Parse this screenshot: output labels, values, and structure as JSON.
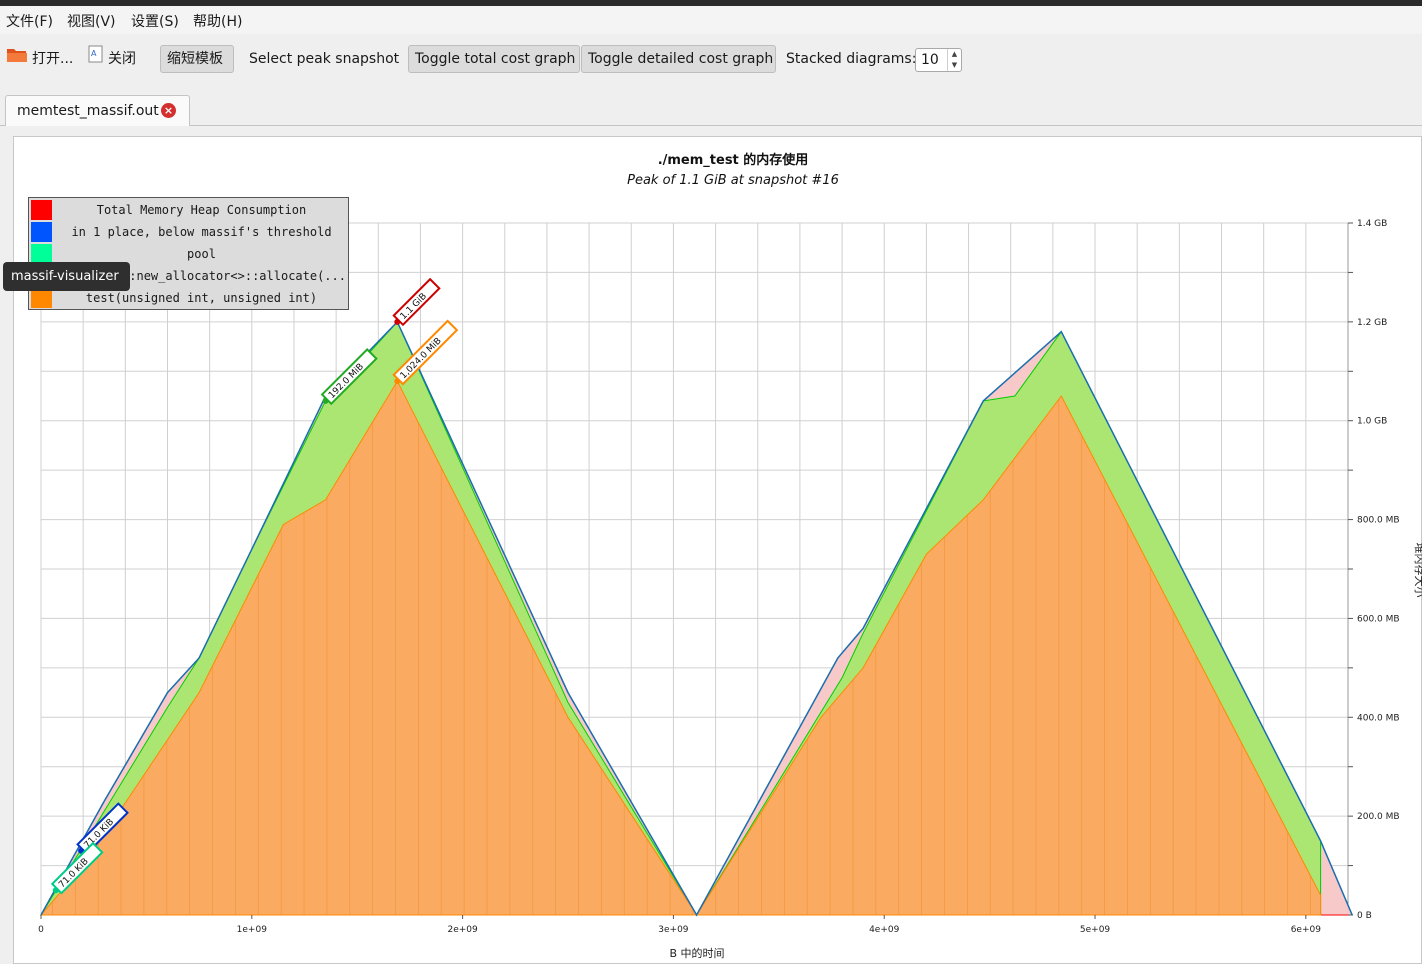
{
  "menubar": {
    "items": [
      "文件(F)",
      "视图(V)",
      "设置(S)",
      "帮助(H)"
    ]
  },
  "toolbar": {
    "open_label": "打开...",
    "close_label": "关闭",
    "shorten_templates_label": "缩短模板",
    "select_peak_label": "Select peak snapshot",
    "toggle_total_label": "Toggle total cost graph",
    "toggle_detailed_label": "Toggle detailed cost graph",
    "stacked_label": "Stacked diagrams:",
    "stacked_value": "10"
  },
  "tab": {
    "label": "memtest_massif.out"
  },
  "tooltip": {
    "text": "massif-visualizer"
  },
  "legend": [
    {
      "label": "Total Memory Heap Consumption",
      "color": "#ff0000"
    },
    {
      "label": "in 1 place, below massif's threshold",
      "color": "#0055ff"
    },
    {
      "label": "pool",
      "color": "#00ff99"
    },
    {
      "label": "__gnu_cxx::new_allocator<>::allocate(...",
      "color": "#00dd00"
    },
    {
      "label": "test(unsigned int, unsigned int)",
      "color": "#ff8800"
    }
  ],
  "chart_data": {
    "type": "area",
    "title": "./mem_test 的内存使用",
    "subtitle": "Peak of 1.1 GiB at snapshot #16",
    "xlabel": "B 中的时间",
    "ylabel": "堆内存大小",
    "xlim": [
      0,
      6200000000
    ],
    "ylim": [
      0,
      1.4
    ],
    "x_ticks": [
      {
        "value": 0,
        "label": "0"
      },
      {
        "value": 1000000000,
        "label": "1e+09"
      },
      {
        "value": 2000000000,
        "label": "2e+09"
      },
      {
        "value": 3000000000,
        "label": "3e+09"
      },
      {
        "value": 4000000000,
        "label": "4e+09"
      },
      {
        "value": 5000000000,
        "label": "5e+09"
      },
      {
        "value": 6000000000,
        "label": "6e+09"
      }
    ],
    "y_ticks": [
      {
        "value": 0,
        "label": "0 B"
      },
      {
        "value": 0.2,
        "label": "200.0 MB"
      },
      {
        "value": 0.4,
        "label": "400.0 MB"
      },
      {
        "value": 0.6,
        "label": "600.0 MB"
      },
      {
        "value": 0.8,
        "label": "800.0 MB"
      },
      {
        "value": 1.0,
        "label": "1.0 GB"
      },
      {
        "value": 1.2,
        "label": "1.2 GB"
      },
      {
        "value": 1.4,
        "label": "1.4 GB"
      }
    ],
    "series": [
      {
        "name": "Total Memory Heap Consumption",
        "color": "#ff0000",
        "fill": "#f7c6c6",
        "points": [
          [
            0,
            0
          ],
          [
            300000000,
            0.23
          ],
          [
            600000000,
            0.45
          ],
          [
            750000000,
            0.52
          ],
          [
            1000000000,
            0.74
          ],
          [
            1350000000,
            1.05
          ],
          [
            1690000000,
            1.2
          ],
          [
            2500000000,
            0.45
          ],
          [
            3110000000,
            0
          ],
          [
            3780000000,
            0.52
          ],
          [
            3900000000,
            0.58
          ],
          [
            4470000000,
            1.04
          ],
          [
            4840000000,
            1.18
          ],
          [
            6070000000,
            0.15
          ],
          [
            6220000000,
            0
          ]
        ]
      },
      {
        "name": "__gnu_cxx::new_allocator<>::allocate(...",
        "color": "#00cc00",
        "fill": "#a8e86e",
        "points": [
          [
            0,
            0
          ],
          [
            600000000,
            0.42
          ],
          [
            750000000,
            0.52
          ],
          [
            1000000000,
            0.74
          ],
          [
            1350000000,
            1.04
          ],
          [
            1690000000,
            1.2
          ],
          [
            2500000000,
            0.43
          ],
          [
            3110000000,
            0
          ],
          [
            3800000000,
            0.48
          ],
          [
            3900000000,
            0.57
          ],
          [
            4470000000,
            1.04
          ],
          [
            4620000000,
            1.05
          ],
          [
            4840000000,
            1.18
          ],
          [
            6070000000,
            0.15
          ],
          [
            6070000000,
            0
          ]
        ]
      },
      {
        "name": "test(unsigned int, unsigned int)",
        "color": "#ff8800",
        "fill": "#ffa860",
        "points": [
          [
            0,
            0
          ],
          [
            200000000,
            0.1
          ],
          [
            750000000,
            0.45
          ],
          [
            1150000000,
            0.79
          ],
          [
            1350000000,
            0.84
          ],
          [
            1690000000,
            1.08
          ],
          [
            2500000000,
            0.4
          ],
          [
            3110000000,
            0
          ],
          [
            3700000000,
            0.4
          ],
          [
            3900000000,
            0.5
          ],
          [
            4200000000,
            0.73
          ],
          [
            4470000000,
            0.84
          ],
          [
            4840000000,
            1.05
          ],
          [
            6070000000,
            0.04
          ],
          [
            6070000000,
            0
          ]
        ]
      }
    ],
    "annotations": [
      {
        "label": "1.1 GiB",
        "x": 1690000000,
        "y": 1.2,
        "color": "#cc0000"
      },
      {
        "label": "1,024.0 MiB",
        "x": 1690000000,
        "y": 1.08,
        "color": "#ff8800"
      },
      {
        "label": "192.0 MiB",
        "x": 1350000000,
        "y": 1.04,
        "color": "#22aa22"
      },
      {
        "label": "71.0 KiB",
        "x": 190000000,
        "y": 0.13,
        "color": "#0033cc"
      },
      {
        "label": "71.0 KiB",
        "x": 70000000,
        "y": 0.05,
        "color": "#00cc88"
      }
    ]
  }
}
